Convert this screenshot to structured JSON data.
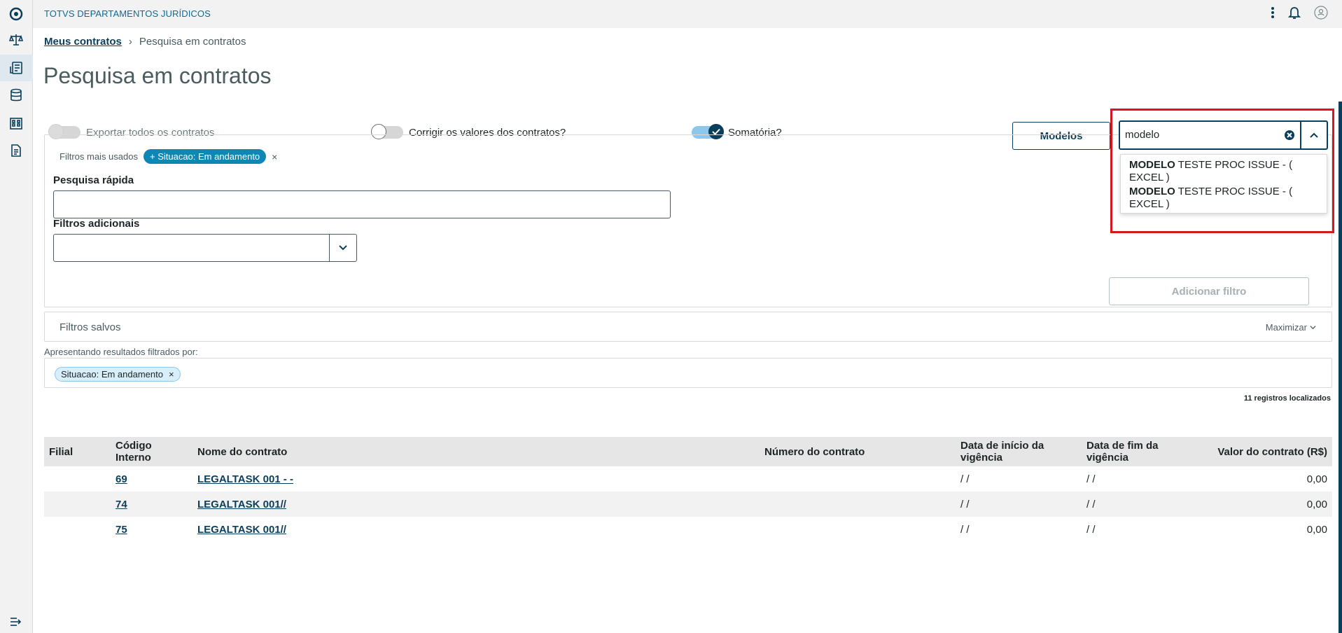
{
  "app": {
    "title": "TOTVS DEPARTAMENTOS JURÍDICOS"
  },
  "sidebar": {
    "icons": [
      "logo-icon",
      "balance-scale-icon",
      "contracts-icon",
      "database-icon",
      "building-icon",
      "document-icon",
      "collapse-menu-icon"
    ],
    "active_index": 2
  },
  "breadcrumb": {
    "parent": "Meus contratos",
    "separator": "›",
    "current": "Pesquisa em contratos"
  },
  "page": {
    "title": "Pesquisa em contratos"
  },
  "toggles": {
    "export_all": {
      "label": "Exportar todos os contratos",
      "state": "off-disabled"
    },
    "fix_values": {
      "label": "Corrigir os valores dos contratos?",
      "state": "off"
    },
    "sum": {
      "label": "Somatória?",
      "state": "on"
    }
  },
  "toolbar": {
    "modelos_label": "Modelos"
  },
  "model_search": {
    "value": "modelo",
    "options": [
      {
        "bold": "MODELO",
        "rest": " TESTE PROC ISSUE - ( EXCEL )"
      },
      {
        "bold": "MODELO",
        "rest": " TESTE PROC ISSUE - ( EXCEL )"
      }
    ]
  },
  "filters": {
    "most_used_label": "Filtros mais usados",
    "most_used_chip": "+ Situacao: Em andamento",
    "chip_remove": "×",
    "quick_search_label": "Pesquisa rápida",
    "quick_search_value": "",
    "additional_label": "Filtros adicionais",
    "additional_value": "",
    "add_filter_label": "Adicionar filtro"
  },
  "saved_filters": {
    "title": "Filtros salvos",
    "maximize_label": "Maximizar"
  },
  "results": {
    "label": "Apresentando resultados filtrados por:",
    "chip": "Situacao: Em andamento",
    "chip_remove": "×",
    "count": "11 registros localizados"
  },
  "table": {
    "headers": [
      "Filial",
      "Código Interno",
      "Nome do contrato",
      "Número do contrato",
      "Data de início da vigência",
      "Data de fim da vigência",
      "Valor do contrato (R$)"
    ],
    "rows": [
      {
        "filial": "",
        "codigo": "69",
        "nome": "LEGALTASK 001 - -",
        "numero": "",
        "inicio": "/ /",
        "fim": "/ /",
        "valor": "0,00"
      },
      {
        "filial": "",
        "codigo": "74",
        "nome": "LEGALTASK 001//",
        "numero": "",
        "inicio": "/ /",
        "fim": "/ /",
        "valor": "0,00"
      },
      {
        "filial": "",
        "codigo": "75",
        "nome": "LEGALTASK 001//",
        "numero": "",
        "inicio": "/ /",
        "fim": "/ /",
        "valor": "0,00"
      }
    ]
  },
  "colors": {
    "primary": "#0b3e5a",
    "accent": "#0f87b4",
    "highlight": "#d7161f"
  }
}
